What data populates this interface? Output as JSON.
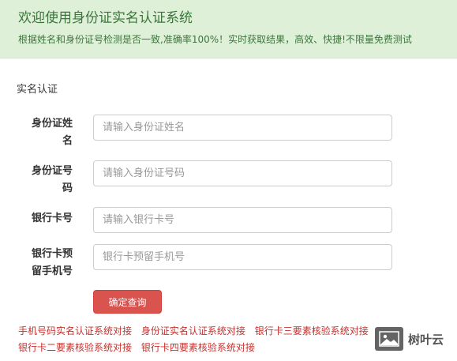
{
  "banner": {
    "title": "欢迎使用身份证实名认证系统",
    "description": "根据姓名和身份证号检测是否一致,准确率100%！实时获取结果，高效、快捷!不限量免费测试"
  },
  "form": {
    "section_title": "实名认证",
    "fields": [
      {
        "label": "身份证姓名",
        "placeholder": "请输入身份证姓名"
      },
      {
        "label": "身份证号码",
        "placeholder": "请输入身份证号码"
      },
      {
        "label": "银行卡号",
        "placeholder": "请输入银行卡号"
      },
      {
        "label": "银行卡预留手机号",
        "placeholder": "银行卡预留手机号"
      }
    ],
    "submit_label": "确定查询"
  },
  "links": [
    "手机号码实名认证系统对接",
    "身份证实名认证系统对接",
    "银行卡三要素核验系统对接",
    "银行卡二要素核验系统对接",
    "银行卡四要素核验系统对接"
  ],
  "watermark": {
    "logo_icon": "picture-icon",
    "text": "树叶云"
  },
  "colors": {
    "banner_bg": "#dff0d8",
    "banner_text": "#3c763d",
    "button_bg": "#d9534f",
    "link": "#c9302c"
  }
}
